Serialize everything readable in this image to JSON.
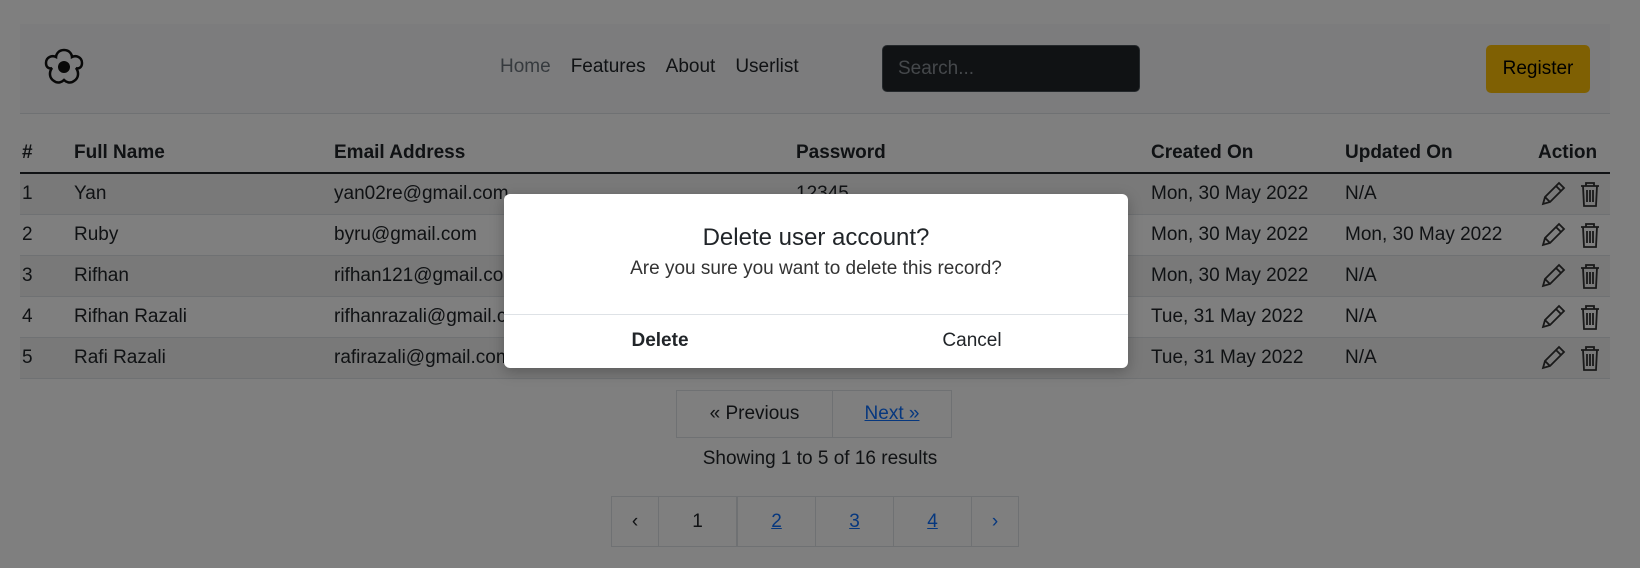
{
  "navbar": {
    "links": [
      {
        "label": "Home"
      },
      {
        "label": "Features"
      },
      {
        "label": "About"
      },
      {
        "label": "Userlist"
      }
    ],
    "search_placeholder": "Search...",
    "register_label": "Register"
  },
  "table": {
    "headers": [
      "#",
      "Full Name",
      "Email Address",
      "Password",
      "Created On",
      "Updated On",
      "Action"
    ],
    "rows": [
      {
        "id": "1",
        "name": "Yan",
        "email": "yan02re@gmail.com",
        "password": "12345",
        "created": "Mon, 30 May 2022",
        "updated": "N/A"
      },
      {
        "id": "2",
        "name": "Ruby",
        "email": "byru@gmail.com",
        "password": "",
        "created": "Mon, 30 May 2022",
        "updated": "Mon, 30 May 2022"
      },
      {
        "id": "3",
        "name": "Rifhan",
        "email": "rifhan121@gmail.com",
        "password": "",
        "created": "Mon, 30 May 2022",
        "updated": "N/A"
      },
      {
        "id": "4",
        "name": "Rifhan Razali",
        "email": "rifhanrazali@gmail.com",
        "password": "",
        "created": "Tue, 31 May 2022",
        "updated": "N/A"
      },
      {
        "id": "5",
        "name": "Rafi Razali",
        "email": "rafirazali@gmail.com",
        "password": "",
        "created": "Tue, 31 May 2022",
        "updated": "N/A"
      }
    ]
  },
  "pagination": {
    "previous_label": "« Previous",
    "next_label": "Next »",
    "results_text": "Showing 1 to 5 of 16 results",
    "prev_arrow": "‹",
    "next_arrow": "›",
    "pages": [
      "1",
      "2",
      "3",
      "4"
    ],
    "current_page": "1"
  },
  "modal": {
    "title": "Delete user account?",
    "message": "Are you sure you want to delete this record?",
    "delete_label": "Delete",
    "cancel_label": "Cancel"
  },
  "colors": {
    "register_bg": "#ffc107",
    "link": "#0d6efd",
    "search_bg": "#212529"
  },
  "icons": {
    "logo": "flower-logo-icon",
    "edit": "pencil-icon",
    "delete": "trash-icon"
  }
}
